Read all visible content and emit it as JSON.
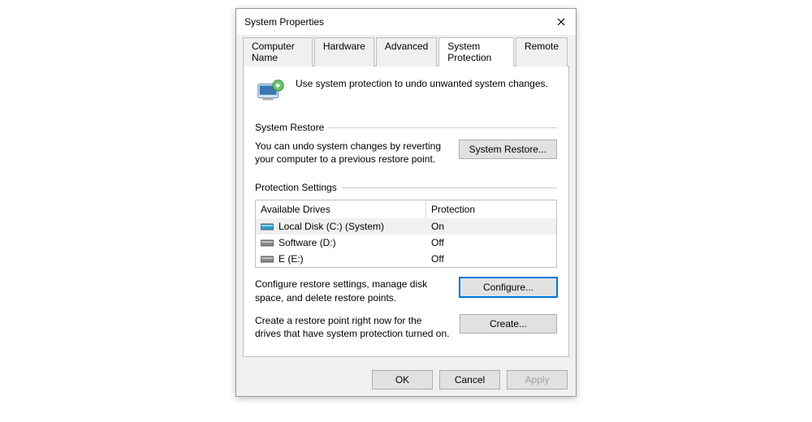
{
  "title": "System Properties",
  "tabs": {
    "computer_name": "Computer Name",
    "hardware": "Hardware",
    "advanced": "Advanced",
    "system_protection": "System Protection",
    "remote": "Remote"
  },
  "intro_text": "Use system protection to undo unwanted system changes.",
  "system_restore": {
    "heading": "System Restore",
    "desc": "You can undo system changes by reverting your computer to a previous restore point.",
    "button": "System Restore..."
  },
  "protection_settings": {
    "heading": "Protection Settings",
    "col_drives": "Available Drives",
    "col_protection": "Protection",
    "drives": [
      {
        "label": "Local Disk (C:) (System)",
        "protection": "On",
        "selected": true,
        "color": "#2a9fd6"
      },
      {
        "label": "Software (D:)",
        "protection": "Off",
        "selected": false,
        "color": "#888"
      },
      {
        "label": "E (E:)",
        "protection": "Off",
        "selected": false,
        "color": "#888"
      }
    ],
    "configure_desc": "Configure restore settings, manage disk space, and delete restore points.",
    "configure_btn": "Configure...",
    "create_desc": "Create a restore point right now for the drives that have system protection turned on.",
    "create_btn": "Create..."
  },
  "footer": {
    "ok": "OK",
    "cancel": "Cancel",
    "apply": "Apply"
  }
}
